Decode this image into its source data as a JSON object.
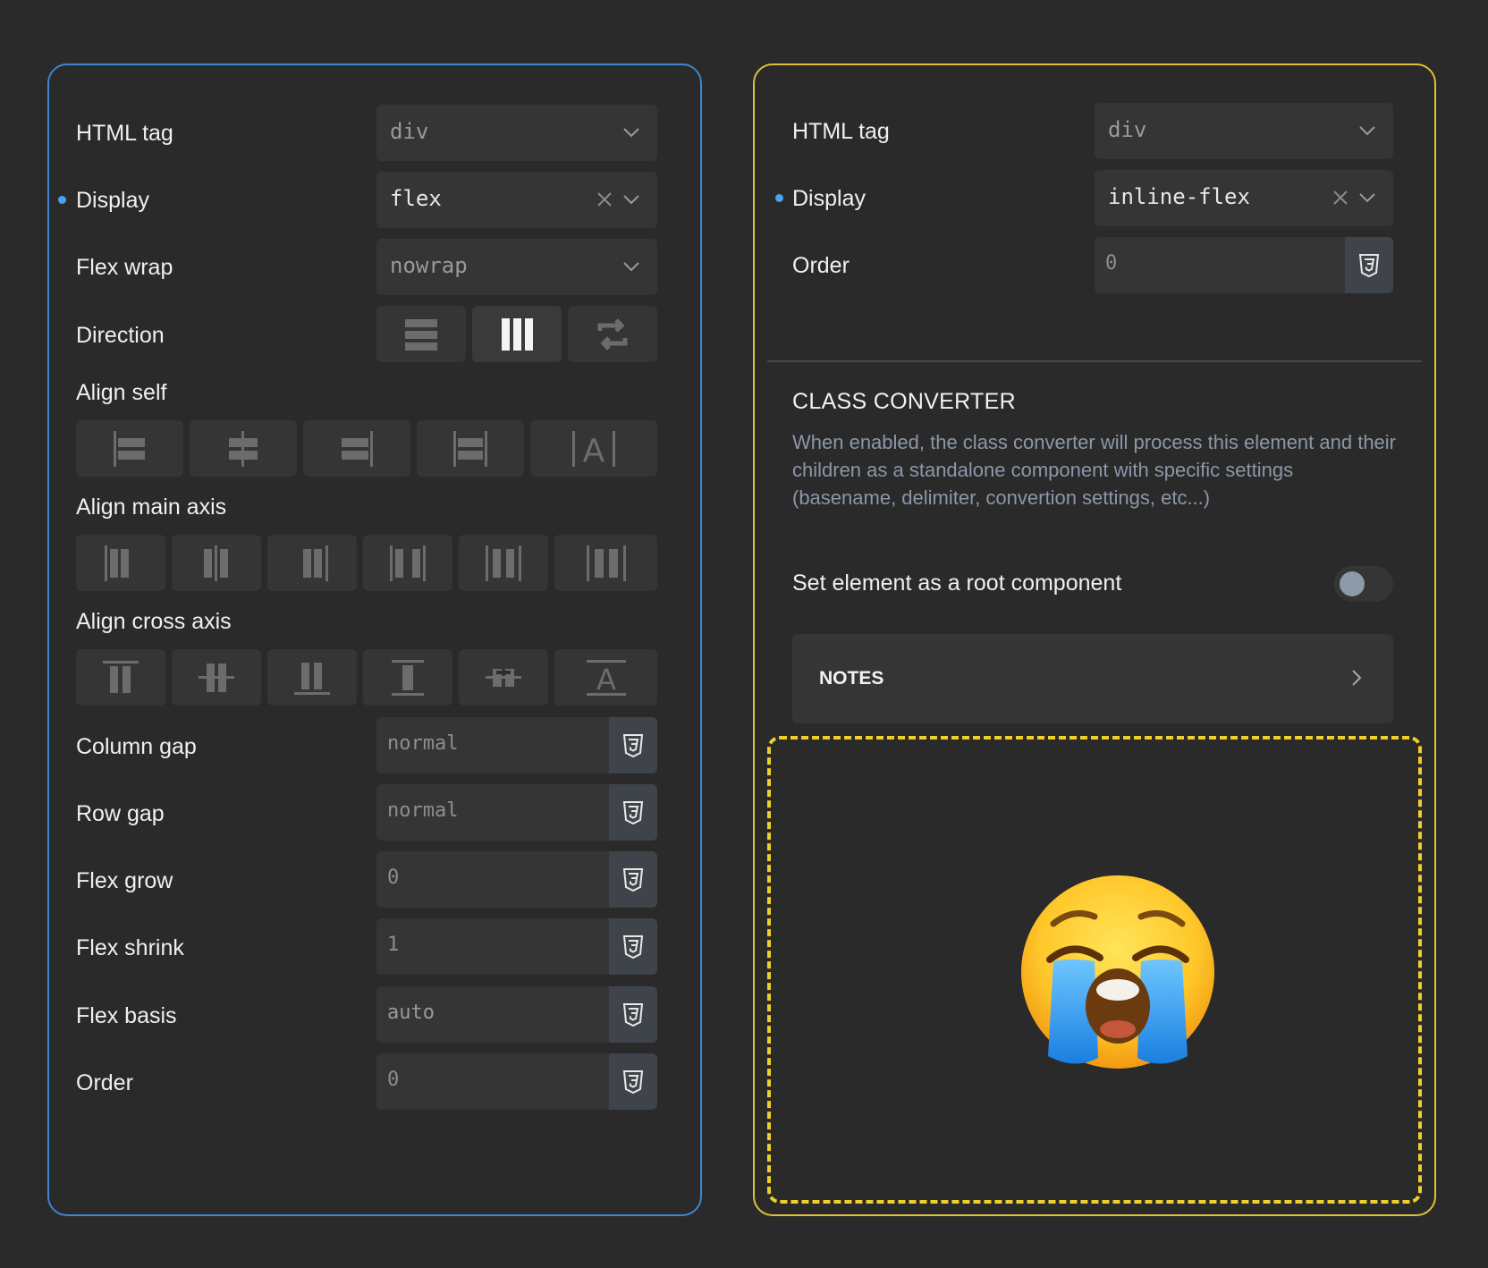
{
  "left_panel": {
    "html_tag": {
      "label": "HTML tag",
      "value": "div"
    },
    "display": {
      "label": "Display",
      "value": "flex"
    },
    "flex_wrap": {
      "label": "Flex wrap",
      "value": "nowrap"
    },
    "direction": {
      "label": "Direction",
      "options": [
        "row-icon",
        "column-icon",
        "reverse-icon"
      ],
      "selected": "column-icon"
    },
    "align_self": {
      "label": "Align self",
      "options": [
        "align-start-icon",
        "align-center-icon",
        "align-end-icon",
        "align-stretch-icon",
        "align-baseline-icon"
      ]
    },
    "align_main_axis": {
      "label": "Align main axis",
      "options": [
        "justify-start-icon",
        "justify-center-icon",
        "justify-end-icon",
        "space-between-icon",
        "space-around-icon",
        "space-evenly-icon"
      ]
    },
    "align_cross_axis": {
      "label": "Align cross axis",
      "options": [
        "cross-start-icon",
        "cross-center-icon",
        "cross-end-icon",
        "cross-stretch-icon",
        "cross-center-alt-icon",
        "cross-baseline-icon"
      ]
    },
    "column_gap": {
      "label": "Column gap",
      "value": "normal"
    },
    "row_gap": {
      "label": "Row gap",
      "value": "normal"
    },
    "flex_grow": {
      "label": "Flex grow",
      "value": "0"
    },
    "flex_shrink": {
      "label": "Flex shrink",
      "value": "1"
    },
    "flex_basis": {
      "label": "Flex basis",
      "value": "auto"
    },
    "order": {
      "label": "Order",
      "value": "0"
    }
  },
  "right_panel": {
    "html_tag": {
      "label": "HTML tag",
      "value": "div"
    },
    "display": {
      "label": "Display",
      "value": "inline-flex"
    },
    "order": {
      "label": "Order",
      "value": "0"
    },
    "class_converter": {
      "title": "CLASS CONVERTER",
      "description": "When enabled, the class converter will process this element and their children as a standalone component with specific settings (basename, delimiter, convertion settings, etc...)",
      "toggle_label": "Set element as a root component",
      "toggle_on": false
    },
    "notes": {
      "label": "NOTES"
    },
    "dropzone_icon": "loudly-crying-face-emoji"
  },
  "colors": {
    "background": "#2a2a2a",
    "field": "#353535",
    "left_border": "#3d86d0",
    "right_border": "#e0c03a",
    "dropzone_dash": "#f0cf2a",
    "modified_dot": "#4aa3f0"
  }
}
